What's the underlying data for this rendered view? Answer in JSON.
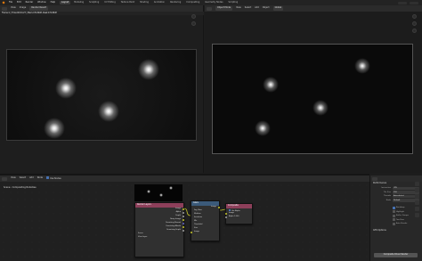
{
  "menubar": {
    "menus": [
      "File",
      "Edit",
      "Render",
      "Window",
      "Help"
    ],
    "tabs": [
      "Layout",
      "Modeling",
      "Sculpting",
      "UV Editing",
      "Texture Paint",
      "Shading",
      "Animation",
      "Rendering",
      "Compositing",
      "Geometry Nodes",
      "Scripting"
    ],
    "active_tab": "Layout"
  },
  "left_editor": {
    "header": {
      "view": "View",
      "image": "Image",
      "slot": "Render Result"
    },
    "status": "Frame:1 | Time:00:04.27 | Mem:474.86M, Peak:474.86M"
  },
  "right_editor": {
    "header": {
      "mode": "Object Mode",
      "view": "View",
      "select": "Select",
      "add": "Add",
      "object": "Object",
      "transform": "Global"
    }
  },
  "node_editor": {
    "header": {
      "view": "View",
      "select": "Select",
      "add": "Add",
      "node": "Node",
      "use_nodes": "Use Nodes"
    },
    "breadcrumb": {
      "scene": "Scene",
      "tree": "Compositing Nodetree"
    },
    "render_layers": {
      "title": "Render Layers",
      "outputs": [
        "Image",
        "Alpha",
        "Depth",
        "Noisy Image",
        "Denoising Normal",
        "Denoising Albedo",
        "Denoising Depth"
      ],
      "scene": "Scene",
      "layer": "View Layer"
    },
    "glare": {
      "title": "Glare",
      "out": "Image",
      "rows": [
        "Fog Glow",
        "Medium",
        "Iterations",
        "Mix",
        "Threshold",
        "Size",
        "Image"
      ]
    },
    "composite": {
      "title": "Composite",
      "use_alpha": "Use Alpha",
      "inputs": [
        "Image",
        "Alpha"
      ],
      "alpha_value": "1.000"
    }
  },
  "properties": {
    "header": "Performance",
    "rows": [
      {
        "label": "Instruction",
        "value": "CPU"
      },
      {
        "label": "Tile Size",
        "value": "256"
      },
      {
        "label": "Threads",
        "value": "Auto-detect"
      },
      {
        "label": "Node",
        "value": "Default"
      }
    ],
    "checks": [
      {
        "label": "Backdrop",
        "on": true
      },
      {
        "label": "Highlight",
        "on": false
      },
      {
        "label": "Buffer Groups",
        "on": false
      },
      {
        "label": "Two Pass",
        "on": false
      },
      {
        "label": "Auto Render",
        "on": false
      }
    ],
    "section2": "GTK Options",
    "render_button": "Composite Driver Render"
  }
}
